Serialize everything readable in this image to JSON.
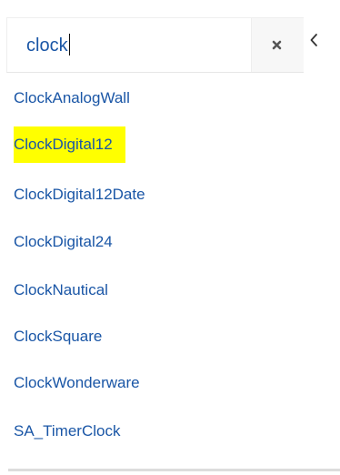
{
  "search": {
    "value": "clock",
    "clear_icon": "close-x-icon",
    "collapse_icon": "chevron-left-icon"
  },
  "results": [
    {
      "label": "ClockAnalogWall",
      "highlighted": false
    },
    {
      "label": "ClockDigital12",
      "highlighted": true
    },
    {
      "label": "ClockDigital12Date",
      "highlighted": false
    },
    {
      "label": "ClockDigital24",
      "highlighted": false
    },
    {
      "label": "ClockNautical",
      "highlighted": false
    },
    {
      "label": "ClockSquare",
      "highlighted": false
    },
    {
      "label": "ClockWonderware",
      "highlighted": false
    },
    {
      "label": "SA_TimerClock",
      "highlighted": false
    }
  ],
  "colors": {
    "link": "#1a56a6",
    "highlight": "#ffff00",
    "icon": "#555555"
  }
}
